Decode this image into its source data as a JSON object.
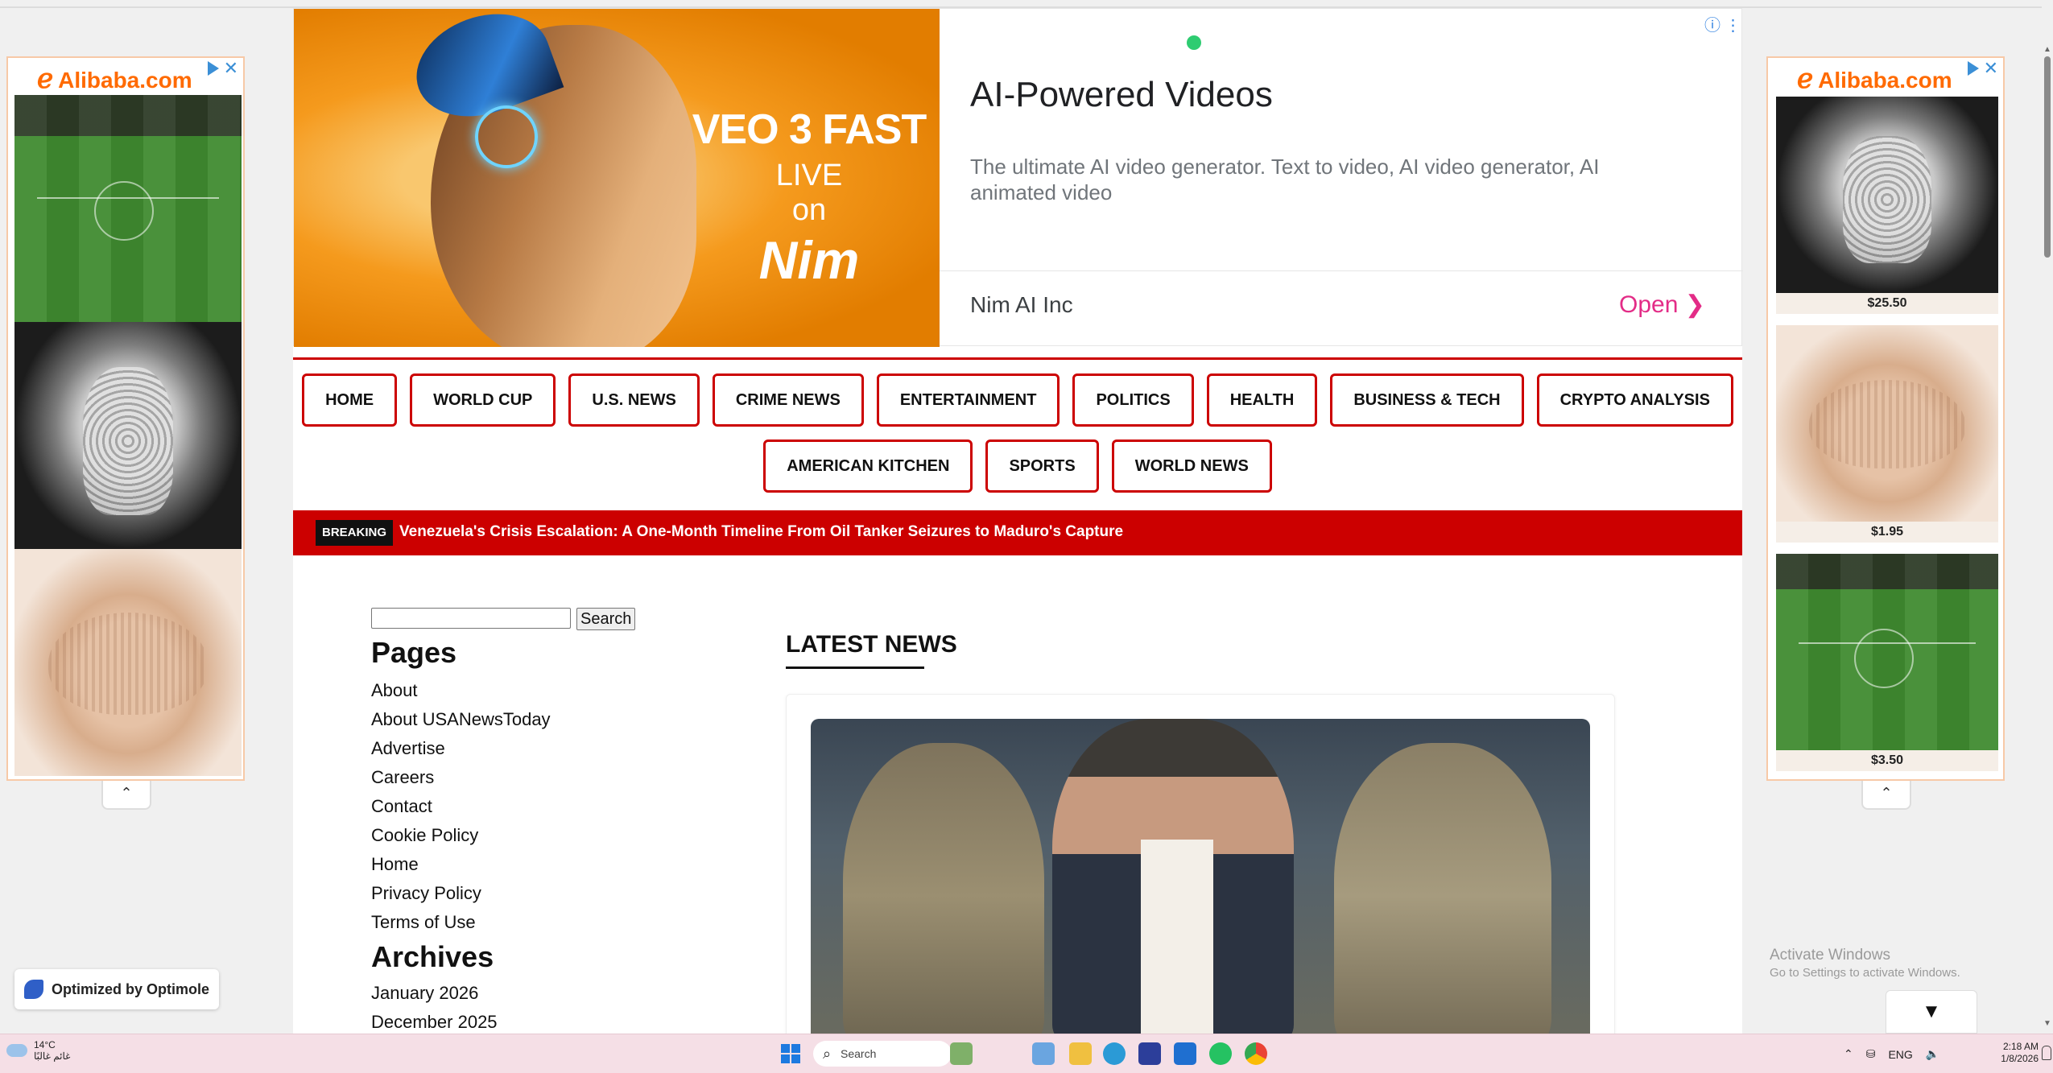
{
  "side_ads": {
    "brand": "Alibaba.com",
    "right_prices": [
      "$25.50",
      "$1.95",
      "$3.50"
    ]
  },
  "top_ad": {
    "image_lines": [
      "VEO 3 FAST",
      "LIVE",
      "on",
      "Nim"
    ],
    "title": "AI-Powered Videos",
    "description": "The ultimate AI video generator. Text to video, AI video generator, AI animated video",
    "advertiser": "Nim AI Inc",
    "cta": "Open"
  },
  "nav": {
    "row1": [
      "HOME",
      "WORLD CUP",
      "U.S. NEWS",
      "CRIME NEWS",
      "ENTERTAINMENT",
      "POLITICS",
      "HEALTH",
      "BUSINESS & TECH",
      "CRYPTO ANALYSIS"
    ],
    "row2": [
      "AMERICAN KITCHEN",
      "SPORTS",
      "WORLD NEWS"
    ]
  },
  "breaking": {
    "label": "BREAKING",
    "headline": "Venezuela's Crisis Escalation: A One-Month Timeline From Oil Tanker Seizures to Maduro's Capture"
  },
  "sidebar": {
    "search_button": "Search",
    "search_value": "",
    "pages_heading": "Pages",
    "pages": [
      "About",
      "About USANewsToday",
      "Advertise",
      "Careers",
      "Contact",
      "Cookie Policy",
      "Home",
      "Privacy Policy",
      "Terms of Use"
    ],
    "archives_heading": "Archives",
    "archives": [
      "January 2026",
      "December 2025"
    ]
  },
  "latest_news": {
    "heading": "LATEST NEWS"
  },
  "optimole": {
    "label": "Optimized by Optimole"
  },
  "watermark": {
    "line1": "Activate Windows",
    "line2": "Go to Settings to activate Windows."
  },
  "taskbar": {
    "weather_temp": "14°C",
    "weather_desc": "غائم غالبًا",
    "search_label": "Search",
    "language": "ENG",
    "time": "2:18 AM",
    "date": "1/8/2026"
  }
}
